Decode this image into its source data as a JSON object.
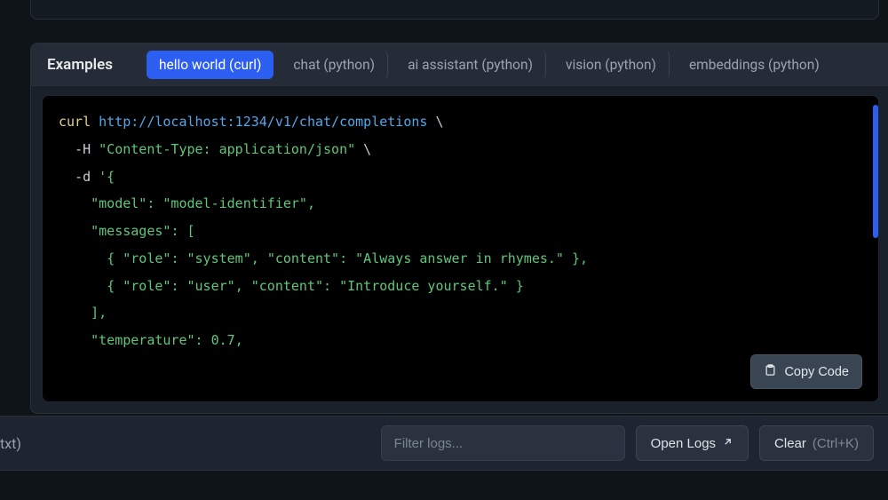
{
  "examples": {
    "label": "Examples",
    "tabs": [
      {
        "label": "hello world (curl)",
        "active": true
      },
      {
        "label": "chat (python)",
        "active": false
      },
      {
        "label": "ai assistant (python)",
        "active": false
      },
      {
        "label": "vision (python)",
        "active": false
      },
      {
        "label": "embeddings (python)",
        "active": false
      }
    ]
  },
  "code": {
    "cmd": "curl",
    "url": "http://localhost:1234/v1/chat/completions",
    "header_flag": "-H",
    "header_value": "\"Content-Type: application/json\"",
    "data_flag": "-d",
    "body_open": "'{",
    "model_key": "\"model\"",
    "model_val": "\"model-identifier\"",
    "messages_key": "\"messages\"",
    "role_key": "\"role\"",
    "content_key": "\"content\"",
    "msg1_role": "\"system\"",
    "msg1_content": "\"Always answer in rhymes.\"",
    "msg2_role": "\"user\"",
    "msg2_content": "\"Introduce yourself.\"",
    "temperature_key": "\"temperature\"",
    "temperature_val": "0.7",
    "backslash": "\\",
    "colon": ": ",
    "comma": ",",
    "lbrace": "{ ",
    "rbrace": " }",
    "lbracket": "[",
    "rbracket": "]"
  },
  "copy_button": "Copy Code",
  "bottom": {
    "txt": "txt)",
    "filter_placeholder": "Filter logs...",
    "open_logs": "Open Logs",
    "clear": "Clear",
    "clear_shortcut": "(Ctrl+K)"
  }
}
